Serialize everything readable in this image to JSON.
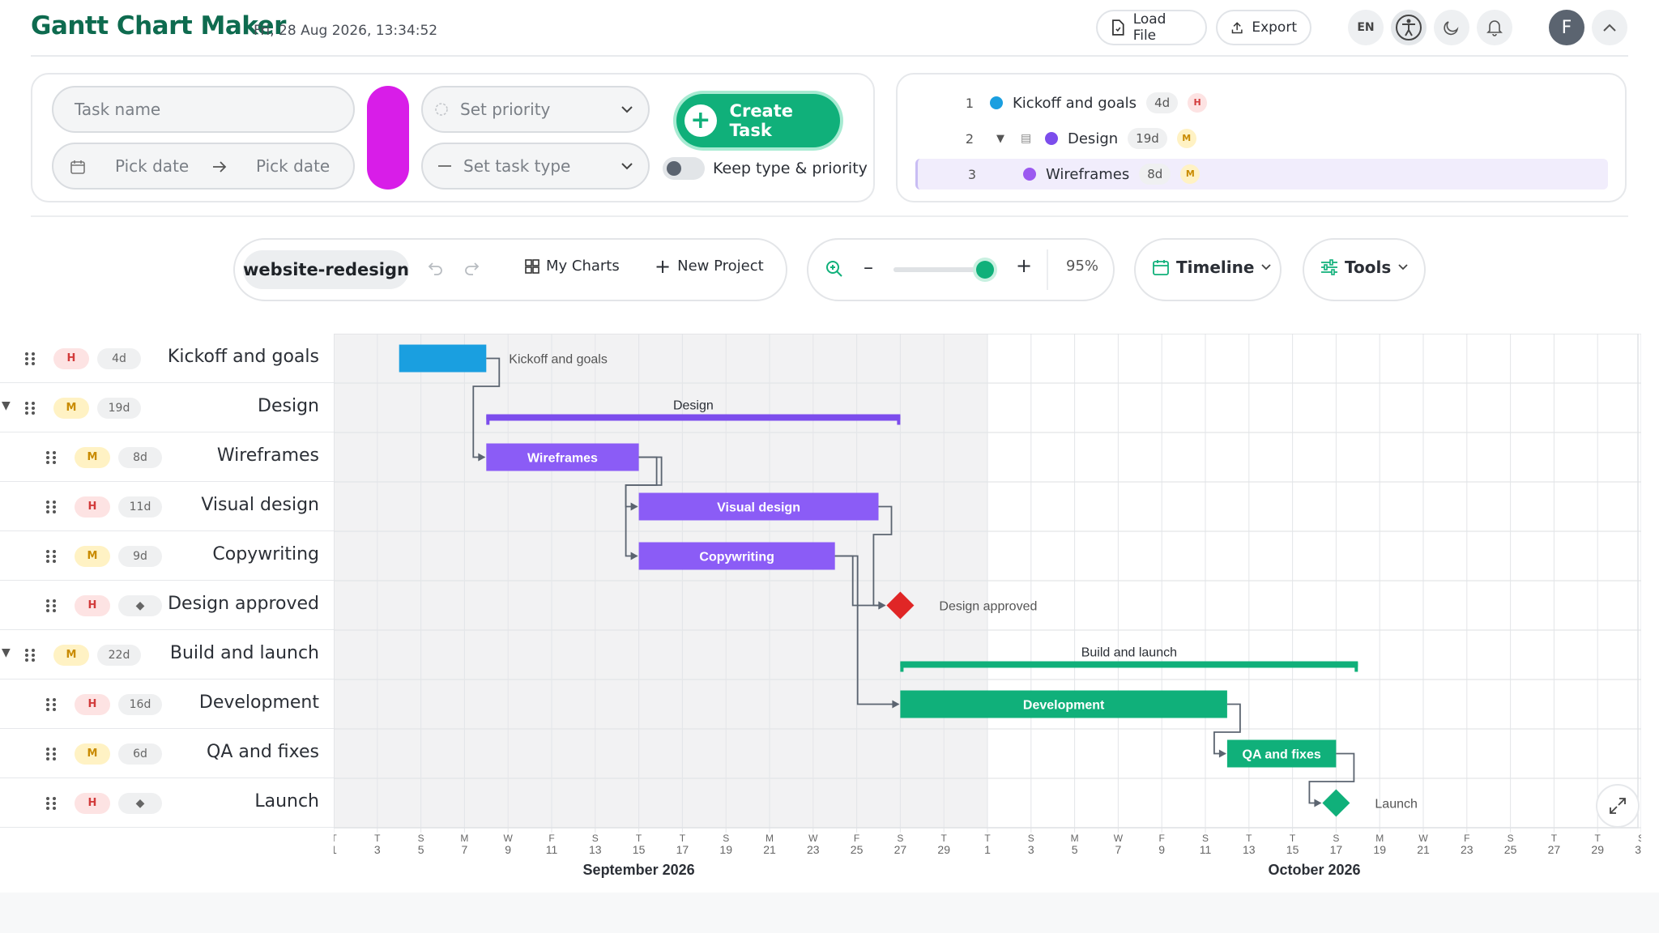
{
  "header": {
    "brand": "Gantt Chart Maker",
    "datetime": "Fri, 28 Aug 2026, 13:34:52",
    "load_file": "Load File",
    "export": "Export",
    "lang": "EN",
    "avatar_initial": "F"
  },
  "form": {
    "task_name_placeholder": "Task name",
    "start_date_placeholder": "Pick date",
    "end_date_placeholder": "Pick date",
    "priority_placeholder": "Set priority",
    "task_type_placeholder": "Set task type",
    "create_label": "Create Task",
    "keep_label": "Keep type & priority",
    "selected_color": "#d81de8",
    "keep_toggle_on": false
  },
  "task_list": [
    {
      "num": "1",
      "name": "Kickoff and goals",
      "duration": "4d",
      "priority": "H",
      "color": "#1a9fe0",
      "level": 0
    },
    {
      "num": "2",
      "name": "Design",
      "duration": "19d",
      "priority": "M",
      "color": "#7c4dec",
      "level": 0,
      "group": true
    },
    {
      "num": "3",
      "name": "Wireframes",
      "duration": "8d",
      "priority": "M",
      "color": "#9b59f0",
      "level": 1,
      "selected": true
    }
  ],
  "toolbar": {
    "project": "website-redesign",
    "my_charts": "My Charts",
    "new_project": "New Project",
    "zoom": "95%",
    "zoom_level": 0.95,
    "view": "Timeline",
    "tools": "Tools"
  },
  "gantt_rows": [
    {
      "name": "Kickoff and goals",
      "priority": "H",
      "duration": "4d",
      "indent": 0,
      "group": false
    },
    {
      "name": "Design",
      "priority": "M",
      "duration": "19d",
      "indent": 0,
      "group": true
    },
    {
      "name": "Wireframes",
      "priority": "M",
      "duration": "8d",
      "indent": 1,
      "group": false
    },
    {
      "name": "Visual design",
      "priority": "H",
      "duration": "11d",
      "indent": 1,
      "group": false
    },
    {
      "name": "Copywriting",
      "priority": "M",
      "duration": "9d",
      "indent": 1,
      "group": false
    },
    {
      "name": "Design approved",
      "priority": "H",
      "duration": "◆",
      "indent": 1,
      "group": false
    },
    {
      "name": "Build and launch",
      "priority": "M",
      "duration": "22d",
      "indent": 0,
      "group": true
    },
    {
      "name": "Development",
      "priority": "H",
      "duration": "16d",
      "indent": 1,
      "group": false
    },
    {
      "name": "QA and fixes",
      "priority": "M",
      "duration": "6d",
      "indent": 1,
      "group": false
    },
    {
      "name": "Launch",
      "priority": "H",
      "duration": "◆",
      "indent": 1,
      "group": false
    }
  ],
  "bars": [
    {
      "task": "Kickoff and goals",
      "start": "2026-09-04",
      "end": "2026-09-08",
      "type": "task",
      "label_outside": true,
      "color": "#1a9fe0"
    },
    {
      "task": "Design",
      "start": "2026-09-08",
      "end": "2026-09-27",
      "type": "group",
      "color": "#7c4dec"
    },
    {
      "task": "Wireframes",
      "start": "2026-09-08",
      "end": "2026-09-15",
      "type": "task",
      "color": "#8b5cf6"
    },
    {
      "task": "Visual design",
      "start": "2026-09-15",
      "end": "2026-09-26",
      "type": "task",
      "color": "#8b5cf6"
    },
    {
      "task": "Copywriting",
      "start": "2026-09-15",
      "end": "2026-09-24",
      "type": "task",
      "color": "#8b5cf6"
    },
    {
      "task": "Design approved",
      "start": "2026-09-27",
      "type": "milestone",
      "label_outside": true,
      "color": "#e02626"
    },
    {
      "task": "Build and launch",
      "start": "2026-09-27",
      "end": "2026-10-18",
      "type": "group",
      "color": "#10b07a"
    },
    {
      "task": "Development",
      "start": "2026-09-27",
      "end": "2026-10-12",
      "type": "task",
      "color": "#10b07a"
    },
    {
      "task": "QA and fixes",
      "start": "2026-10-12",
      "end": "2026-10-17",
      "type": "task",
      "color": "#10b07a"
    },
    {
      "task": "Launch",
      "start": "2026-10-17",
      "type": "milestone",
      "label_outside": true,
      "color": "#10b07a"
    }
  ],
  "dependencies": [
    {
      "from": "Kickoff and goals",
      "to": "Wireframes"
    },
    {
      "from": "Wireframes",
      "to": "Visual design"
    },
    {
      "from": "Wireframes",
      "to": "Copywriting"
    },
    {
      "from": "Visual design",
      "to": "Design approved"
    },
    {
      "from": "Copywriting",
      "to": "Design approved"
    },
    {
      "from": "Copywriting",
      "to": "Development"
    },
    {
      "from": "Development",
      "to": "QA and fixes"
    },
    {
      "from": "QA and fixes",
      "to": "Launch"
    }
  ],
  "timeline": {
    "start_date": "2026-09-01",
    "end_date": "2026-10-31",
    "tick_every_days": 2,
    "highlight_until": "2026-10-01",
    "months": [
      "September 2026",
      "October 2026"
    ],
    "weekday_initials": [
      "S",
      "M",
      "T",
      "W",
      "T",
      "F",
      "S"
    ]
  }
}
